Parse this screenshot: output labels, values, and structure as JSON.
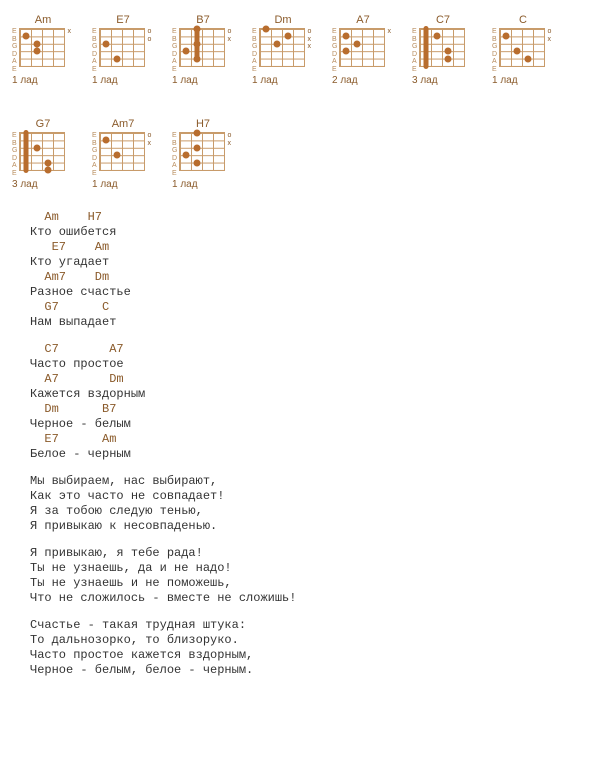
{
  "string_labels": [
    "E",
    "B",
    "G",
    "D",
    "A",
    "E"
  ],
  "chords": [
    {
      "name": "Am",
      "fret_label": "1 лад",
      "barre": null,
      "dots": [
        {
          "f": 1,
          "s": 2
        },
        {
          "f": 2,
          "s": 4
        },
        {
          "f": 2,
          "s": 3
        }
      ],
      "marks": [
        "",
        "",
        "",
        "",
        "",
        "x"
      ]
    },
    {
      "name": "E7",
      "fret_label": "1 лад",
      "barre": null,
      "dots": [
        {
          "f": 1,
          "s": 3
        },
        {
          "f": 2,
          "s": 5
        }
      ],
      "marks": [
        "",
        "",
        "",
        "o",
        "",
        "o"
      ]
    },
    {
      "name": "B7",
      "fret_label": "1 лад",
      "barre": {
        "f": 2,
        "from": 1,
        "to": 5
      },
      "dots": [
        {
          "f": 1,
          "s": 4
        },
        {
          "f": 2,
          "s": 5
        },
        {
          "f": 2,
          "s": 3
        },
        {
          "f": 2,
          "s": 1
        }
      ],
      "marks": [
        "",
        "o",
        "",
        "",
        "",
        "x"
      ]
    },
    {
      "name": "Dm",
      "fret_label": "1 лад",
      "barre": null,
      "dots": [
        {
          "f": 1,
          "s": 1
        },
        {
          "f": 2,
          "s": 3
        },
        {
          "f": 3,
          "s": 2
        }
      ],
      "marks": [
        "",
        "",
        "",
        "o",
        "x",
        "x"
      ]
    },
    {
      "name": "A7",
      "fret_label": "2 лад",
      "barre": null,
      "dots": [
        {
          "f": 1,
          "s": 4
        },
        {
          "f": 1,
          "s": 2
        },
        {
          "f": 2,
          "s": 3
        }
      ],
      "marks": [
        "",
        "",
        "",
        "",
        "",
        "x"
      ]
    },
    {
      "name": "C7",
      "fret_label": "3 лад",
      "barre": {
        "f": 1,
        "from": 1,
        "to": 6
      },
      "dots": [
        {
          "f": 2,
          "s": 2
        },
        {
          "f": 3,
          "s": 5
        },
        {
          "f": 3,
          "s": 4
        }
      ],
      "marks": [
        "",
        "",
        "",
        "",
        "",
        ""
      ]
    },
    {
      "name": "C",
      "fret_label": "1 лад",
      "barre": null,
      "dots": [
        {
          "f": 1,
          "s": 2
        },
        {
          "f": 2,
          "s": 4
        },
        {
          "f": 3,
          "s": 5
        }
      ],
      "marks": [
        "",
        "",
        "o",
        "",
        "",
        "x"
      ]
    },
    {
      "name": "G7",
      "fret_label": "3 лад",
      "barre": {
        "f": 1,
        "from": 1,
        "to": 6
      },
      "dots": [
        {
          "f": 2,
          "s": 3
        },
        {
          "f": 3,
          "s": 5
        },
        {
          "f": 3,
          "s": 6
        }
      ],
      "marks": [
        "",
        "",
        "",
        "",
        "",
        ""
      ]
    },
    {
      "name": "Am7",
      "fret_label": "1 лад",
      "barre": null,
      "dots": [
        {
          "f": 1,
          "s": 2
        },
        {
          "f": 2,
          "s": 4
        }
      ],
      "marks": [
        "",
        "",
        "o",
        "",
        "",
        "x"
      ]
    },
    {
      "name": "H7",
      "fret_label": "1 лад",
      "barre": null,
      "dots": [
        {
          "f": 1,
          "s": 4
        },
        {
          "f": 2,
          "s": 5
        },
        {
          "f": 2,
          "s": 3
        },
        {
          "f": 2,
          "s": 1
        }
      ],
      "marks": [
        "",
        "o",
        "",
        "",
        "",
        "x"
      ]
    }
  ],
  "lyrics": [
    {
      "type": "ch",
      "text": "  Am    H7"
    },
    {
      "type": "tx",
      "text": "Кто ошибется"
    },
    {
      "type": "ch",
      "text": "   E7    Am"
    },
    {
      "type": "tx",
      "text": "Кто угадает"
    },
    {
      "type": "ch",
      "text": "  Am7    Dm"
    },
    {
      "type": "tx",
      "text": "Разное счастье"
    },
    {
      "type": "ch",
      "text": "  G7      C"
    },
    {
      "type": "tx",
      "text": "Нам выпадает"
    },
    {
      "type": "br"
    },
    {
      "type": "ch",
      "text": "  C7       A7"
    },
    {
      "type": "tx",
      "text": "Часто простое"
    },
    {
      "type": "ch",
      "text": "  A7       Dm"
    },
    {
      "type": "tx",
      "text": "Кажется вздорным"
    },
    {
      "type": "ch",
      "text": "  Dm      B7"
    },
    {
      "type": "tx",
      "text": "Черное - белым"
    },
    {
      "type": "ch",
      "text": "  E7      Am"
    },
    {
      "type": "tx",
      "text": "Белое - черным"
    },
    {
      "type": "br"
    },
    {
      "type": "tx",
      "text": "Мы выбираем, нас выбирают,"
    },
    {
      "type": "tx",
      "text": "Как это часто не совпадает!"
    },
    {
      "type": "tx",
      "text": "Я за тобою следую тенью,"
    },
    {
      "type": "tx",
      "text": "Я привыкаю к несовпаденью."
    },
    {
      "type": "br"
    },
    {
      "type": "tx",
      "text": "Я привыкаю, я тебе рада!"
    },
    {
      "type": "tx",
      "text": "Ты не узнаешь, да и не надо!"
    },
    {
      "type": "tx",
      "text": "Ты не узнаешь и не поможешь,"
    },
    {
      "type": "tx",
      "text": "Что не сложилось - вместе не сложишь!"
    },
    {
      "type": "br"
    },
    {
      "type": "tx",
      "text": "Счастье - такая трудная штука:"
    },
    {
      "type": "tx",
      "text": "То дальнозорко, то близоруко."
    },
    {
      "type": "tx",
      "text": "Часто простое кажется вздорным,"
    },
    {
      "type": "tx",
      "text": "Черное - белым, белое - черным."
    }
  ]
}
